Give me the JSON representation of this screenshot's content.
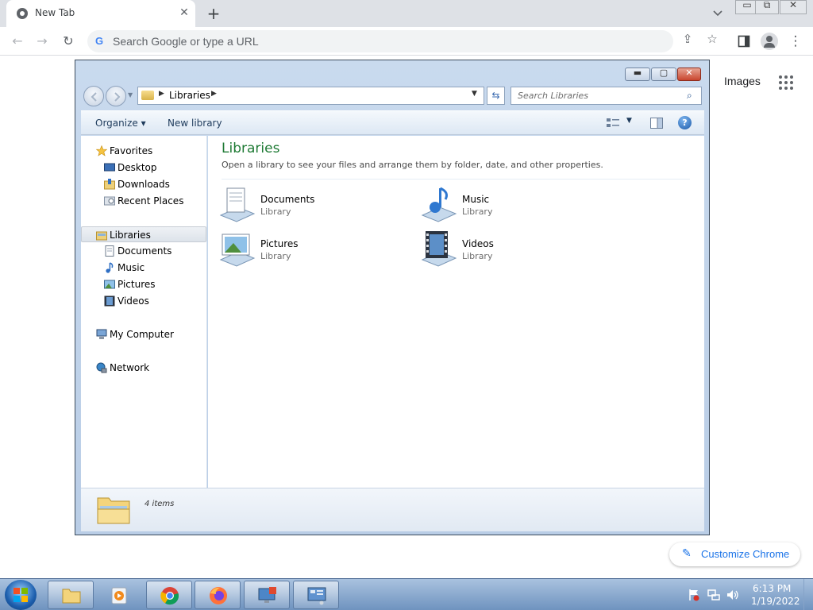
{
  "chrome": {
    "tab_title": "New Tab",
    "tab_close": "✕",
    "new_tab": "+",
    "tab_search": "⌄",
    "omnibox_placeholder": "Search Google or type a URL",
    "google_letter": "G",
    "images_link": "Images",
    "customize_label": "Customize Chrome",
    "customize_icon": "✎",
    "back": "←",
    "forward": "→",
    "reload": "↻",
    "share": "⇪",
    "star": "☆",
    "menu": "⋮"
  },
  "window_controls": {
    "minimize": "▭",
    "restore": "⧉",
    "close": "✕"
  },
  "explorer": {
    "breadcrumb": "Libraries",
    "search_placeholder": "Search Libraries",
    "title_buttons": {
      "minimize": "▬",
      "maximize": "▢",
      "close": "✕"
    },
    "toolbar": {
      "organize": "Organize",
      "organize_caret": "▾",
      "new_library": "New library",
      "help": "?"
    },
    "nav": {
      "favorites": "Favorites",
      "desktop": "Desktop",
      "downloads": "Downloads",
      "recent_places": "Recent Places",
      "libraries": "Libraries",
      "documents": "Documents",
      "music": "Music",
      "pictures": "Pictures",
      "videos": "Videos",
      "my_computer": "My Computer",
      "network": "Network"
    },
    "content": {
      "heading": "Libraries",
      "subheading": "Open a library to see your files and arrange them by folder, date, and other properties.",
      "libraries": [
        {
          "name": "Documents",
          "type": "Library"
        },
        {
          "name": "Music",
          "type": "Library"
        },
        {
          "name": "Pictures",
          "type": "Library"
        },
        {
          "name": "Videos",
          "type": "Library"
        }
      ]
    },
    "details": {
      "count": "4 items"
    }
  },
  "taskbar": {
    "time": "6:13 PM",
    "date": "1/19/2022"
  },
  "colors": {
    "library_heading": "#1e7a34",
    "close_button": "#c8452e",
    "chrome_accent": "#1a73e8"
  }
}
